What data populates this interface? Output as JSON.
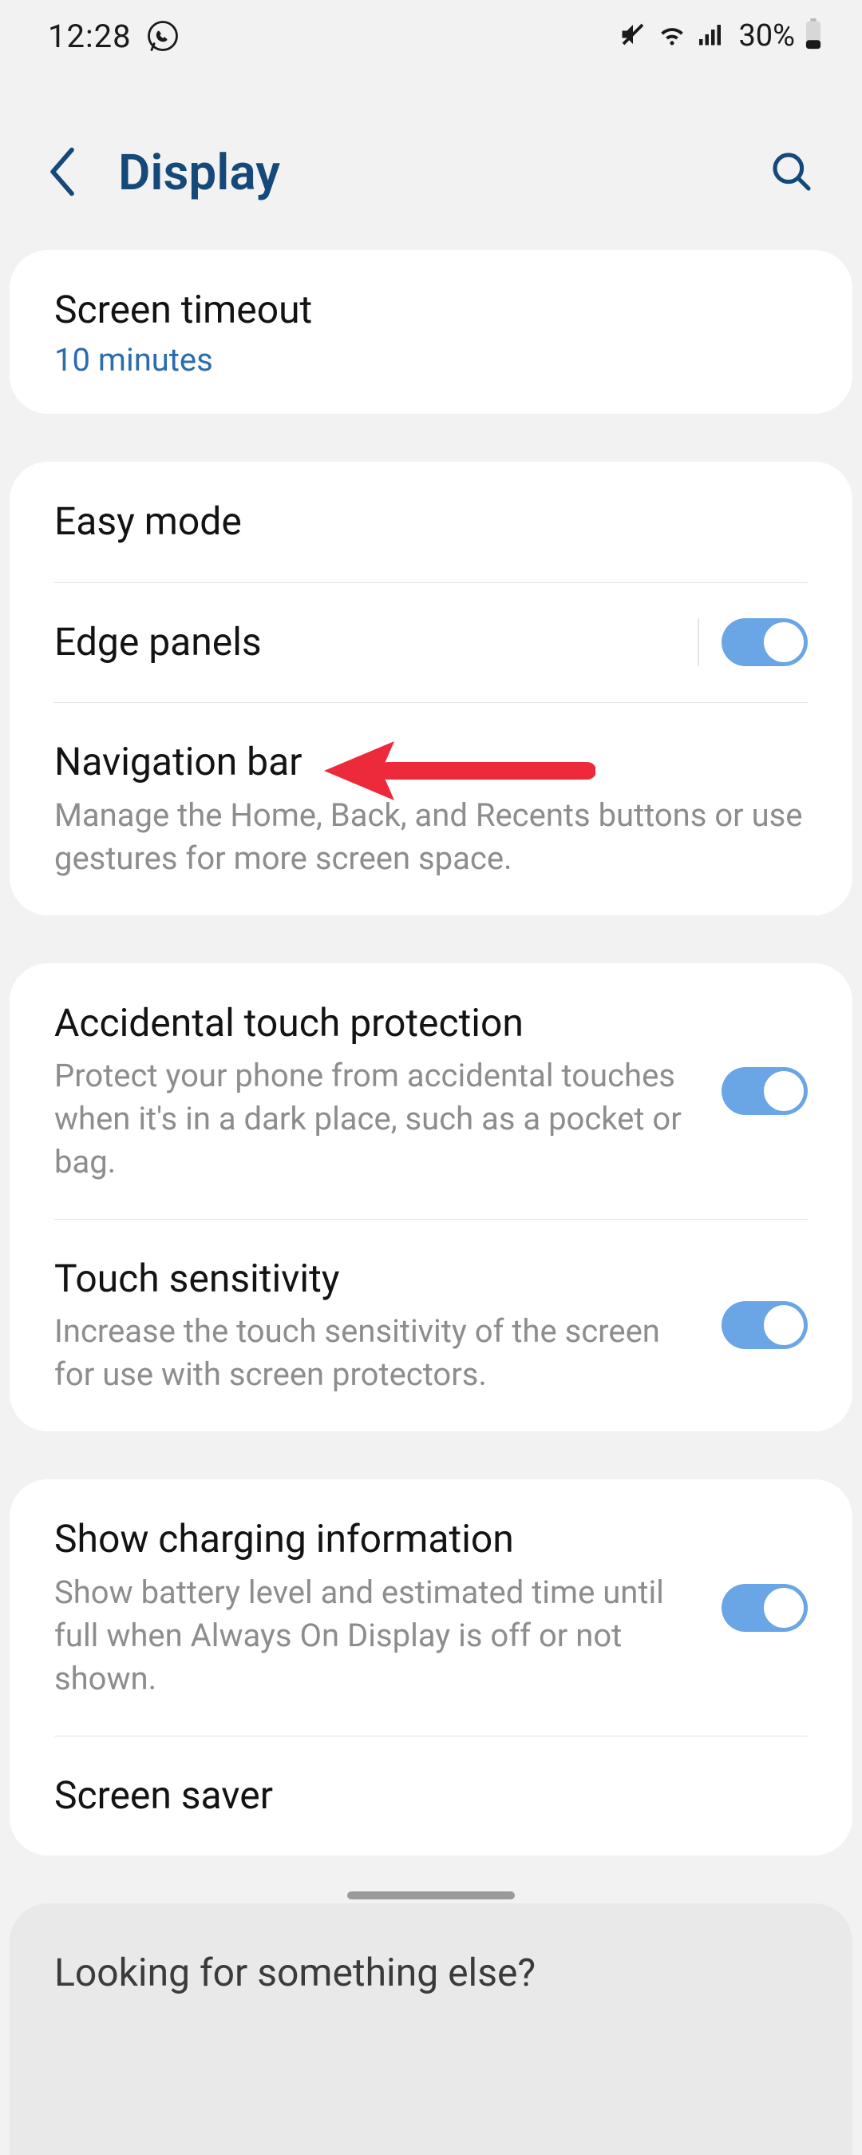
{
  "status": {
    "time": "12:28",
    "battery_pct": "30%"
  },
  "header": {
    "title": "Display"
  },
  "rows": {
    "screen_timeout": {
      "title": "Screen timeout",
      "value": "10 minutes"
    },
    "easy_mode": {
      "title": "Easy mode"
    },
    "edge_panels": {
      "title": "Edge panels",
      "toggle": true
    },
    "nav_bar": {
      "title": "Navigation bar",
      "desc": "Manage the Home, Back, and Recents buttons or use gestures for more screen space."
    },
    "accidental": {
      "title": "Accidental touch protection",
      "desc": "Protect your phone from accidental touches when it's in a dark place, such as a pocket or bag.",
      "toggle": true
    },
    "touch_sens": {
      "title": "Touch sensitivity",
      "desc": "Increase the touch sensitivity of the screen for use with screen protectors.",
      "toggle": true
    },
    "charging_info": {
      "title": "Show charging information",
      "desc": "Show battery level and estimated time until full when Always On Display is off or not shown.",
      "toggle": true
    },
    "screen_saver": {
      "title": "Screen saver"
    }
  },
  "footer": {
    "title": "Looking for something else?"
  },
  "colors": {
    "accent": "#15497a",
    "link": "#2c6bad",
    "toggle_on": "#6aa6e6",
    "annotation": "#ec2a3b"
  }
}
